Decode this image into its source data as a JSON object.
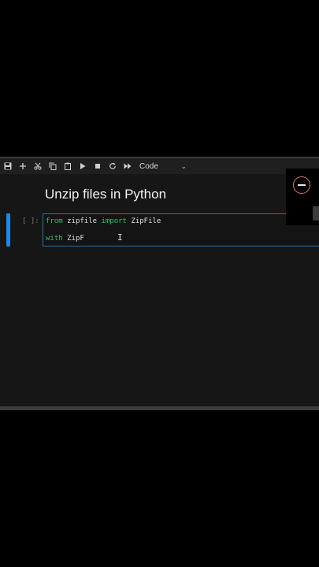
{
  "toolbar": {
    "buttons": [
      {
        "name": "save-icon"
      },
      {
        "name": "add-icon"
      },
      {
        "name": "cut-icon"
      },
      {
        "name": "copy-icon"
      },
      {
        "name": "paste-icon"
      },
      {
        "name": "run-icon"
      },
      {
        "name": "stop-icon"
      },
      {
        "name": "restart-icon"
      },
      {
        "name": "fast-forward-icon"
      }
    ],
    "cell_type": "Code"
  },
  "notebook": {
    "heading": "Unzip files in Python",
    "cell": {
      "prompt": "[ ]:",
      "line1": {
        "kw1": "from",
        "t1": " zipfile ",
        "kw2": "import",
        "t2": " ZipFile"
      },
      "line2": {
        "kw1": "with",
        "t1": " ZipF"
      }
    }
  },
  "colors": {
    "keyword": "#31c26a",
    "active_cell": "#1e88e5",
    "accent_overlay": "#d87a6a"
  }
}
